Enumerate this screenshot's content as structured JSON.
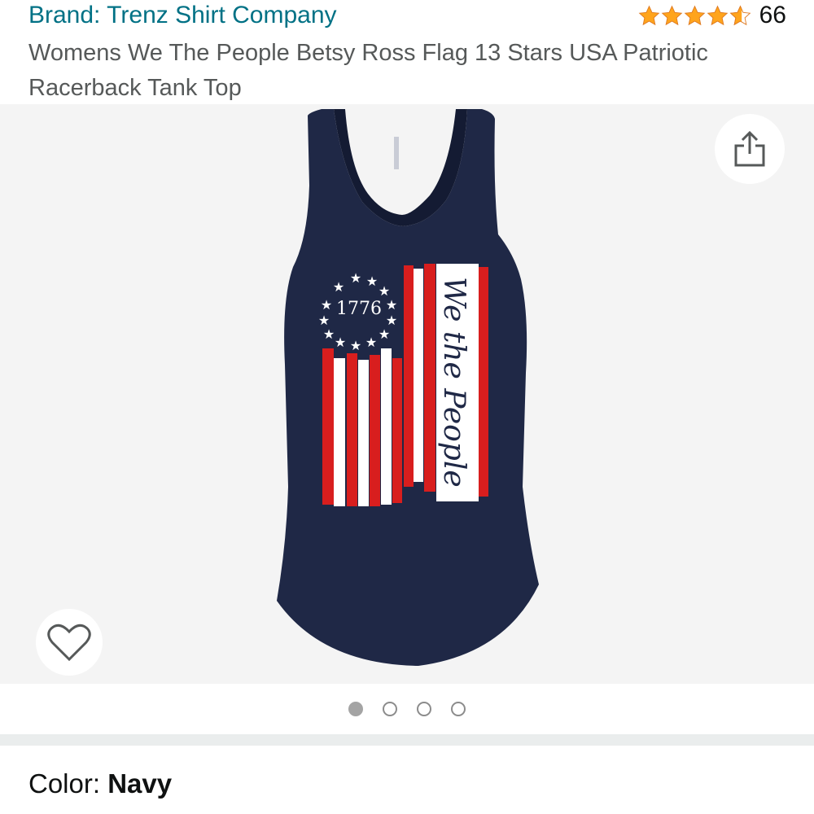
{
  "header": {
    "brand": "Brand: Trenz Shirt Company",
    "rating_value": 4.5,
    "rating_count": "66",
    "title": "Womens We The People Betsy Ross Flag 13 Stars USA Patriotic Racerback Tank Top"
  },
  "gallery": {
    "print_year": "1776",
    "print_script": "We the People",
    "image_count": 4,
    "active_index": 0
  },
  "color": {
    "label": "Color: ",
    "value": "Navy"
  },
  "colors": {
    "link": "#007185",
    "star": "#ffa41c",
    "shirt": "#1f2846",
    "flag_red": "#d81e1e"
  },
  "icons": [
    "star-icon",
    "share-icon",
    "heart-icon"
  ]
}
